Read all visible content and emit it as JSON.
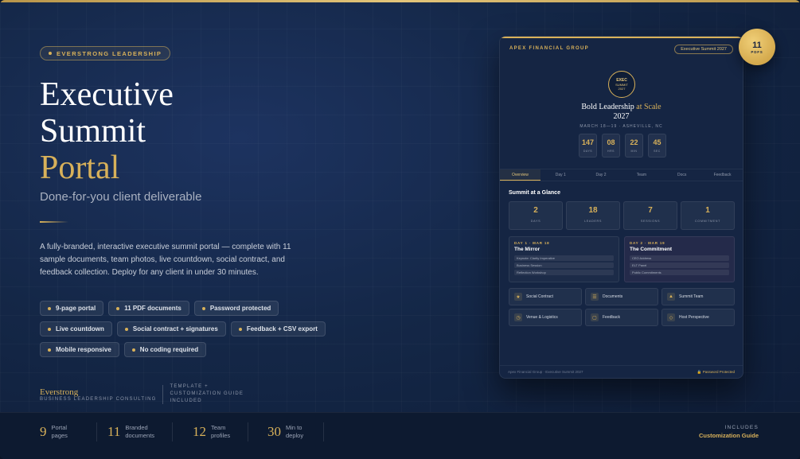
{
  "brand_pill": "EVERSTRONG LEADERSHIP",
  "hero": {
    "line1": "Executive",
    "line2": "Summit",
    "line3": "Portal"
  },
  "subtitle": "Done-for-you client deliverable",
  "description": "A fully-branded, interactive executive summit portal — complete with 11 sample documents, team photos, live countdown, social contract, and feedback collection. Deploy for any client in under 30 minutes.",
  "features": [
    "9-page portal",
    "11 PDF documents",
    "Password protected",
    "Live countdown",
    "Social contract + signatures",
    "Feedback + CSV export",
    "Mobile responsive",
    "No coding required"
  ],
  "brand": {
    "name": "Everstrong",
    "tagline": "BUSINESS LEADERSHIP CONSULTING",
    "note": "TEMPLATE + CUSTOMIZATION GUIDE INCLUDED"
  },
  "stats": [
    {
      "num": "9",
      "label1": "Portal",
      "label2": "pages"
    },
    {
      "num": "11",
      "label1": "Branded",
      "label2": "documents"
    },
    {
      "num": "12",
      "label1": "Team",
      "label2": "profiles"
    },
    {
      "num": "30",
      "label1": "Min to",
      "label2": "deploy"
    }
  ],
  "includes": {
    "label": "INCLUDES",
    "value": "Customization Guide"
  },
  "pdf_badge": {
    "count": "11",
    "unit": "PDFS"
  },
  "device": {
    "org": "APEX FINANCIAL GROUP",
    "badge": "Executive Summit 2027",
    "seal": {
      "line1": "EXEC",
      "line2": "SUMMIT",
      "line3": "2027"
    },
    "title_main": "Bold Leadership",
    "title_accent": "at Scale",
    "title_year": "2027",
    "date": "MARCH 18—19 · ASHEVILLE, NC",
    "countdown": [
      {
        "value": "147",
        "unit": "DAYS"
      },
      {
        "value": "08",
        "unit": "HRS"
      },
      {
        "value": "22",
        "unit": "MIN"
      },
      {
        "value": "45",
        "unit": "SEC"
      }
    ],
    "tabs": [
      "Overview",
      "Day 1",
      "Day 2",
      "Team",
      "Docs",
      "Feedback"
    ],
    "glance_heading": "Summit at a Glance",
    "glance": [
      {
        "value": "2",
        "unit": "DAYS"
      },
      {
        "value": "18",
        "unit": "LEADERS"
      },
      {
        "value": "7",
        "unit": "SESSIONS"
      },
      {
        "value": "1",
        "unit": "COMMITMENT"
      }
    ],
    "days": [
      {
        "head": "DAY 1 · MAR 18",
        "title": "The Mirror",
        "items": [
          "Keynote: Clarity Imperative",
          "Business Session",
          "Reflection Workshop"
        ]
      },
      {
        "head": "DAY 2 · MAR 19",
        "title": "The Commitment",
        "items": [
          "CEO Address",
          "ELT Panel",
          "Public Commitments"
        ]
      }
    ],
    "links": [
      {
        "icon": "★",
        "label": "Social Contract"
      },
      {
        "icon": "☰",
        "label": "Documents"
      },
      {
        "icon": "▲",
        "label": "Summit Team"
      },
      {
        "icon": "◷",
        "label": "Venue & Logistics"
      },
      {
        "icon": "▢",
        "label": "Feedback"
      },
      {
        "icon": "◇",
        "label": "Host Perspective"
      }
    ],
    "footer_left": "Apex Financial Group · Executive Summit 2027",
    "footer_right": "🔒 Password Protected"
  },
  "colors": {
    "accent": "#d8b15a",
    "background": "#142747",
    "card": "#152543"
  }
}
